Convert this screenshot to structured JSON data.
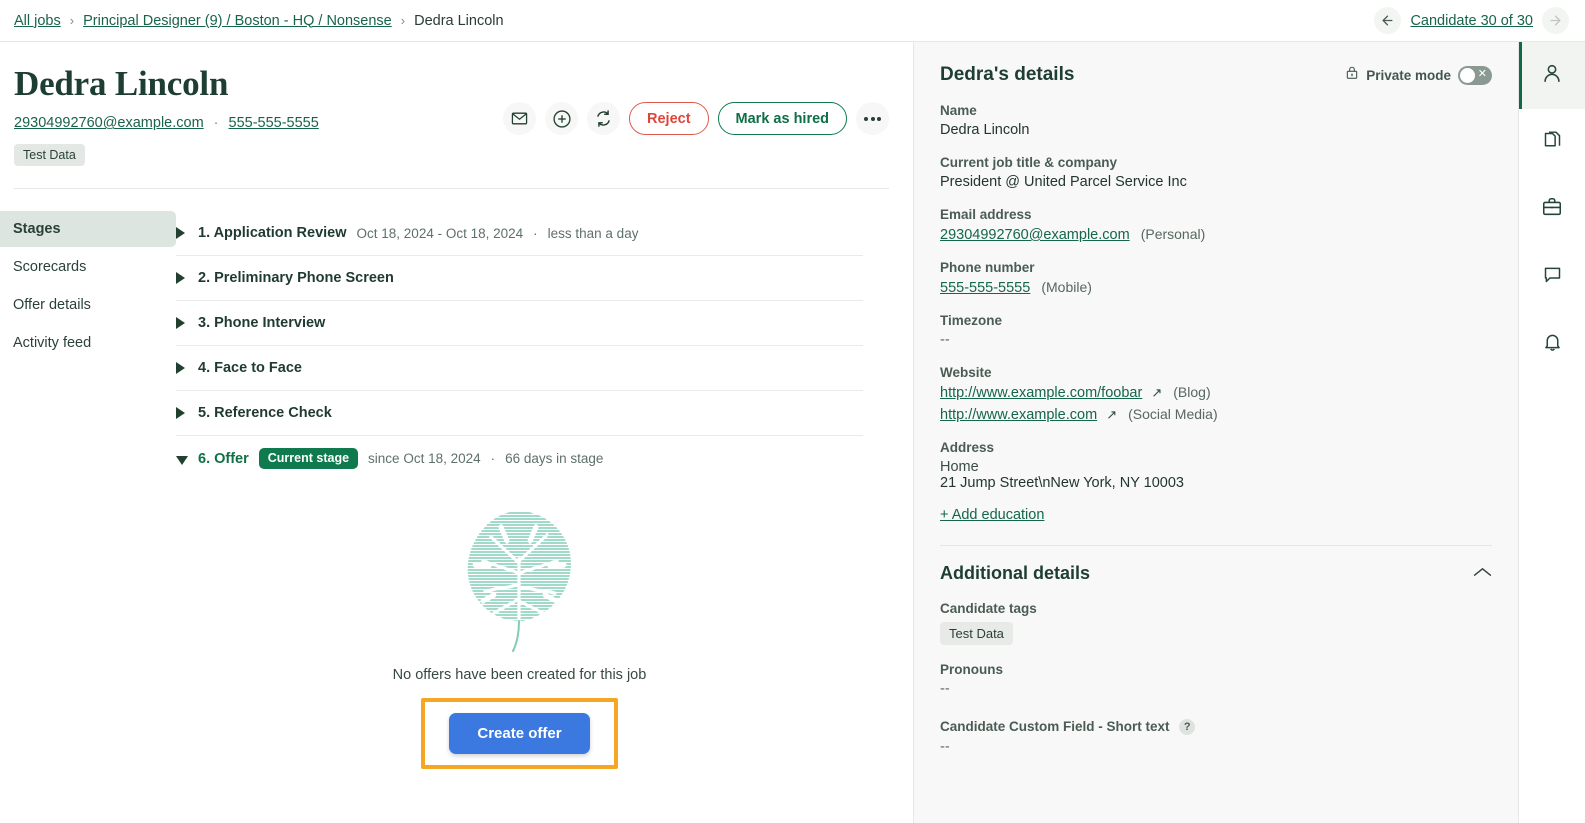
{
  "breadcrumb": {
    "all_jobs": "All jobs",
    "job": "Principal Designer (9) / Boston - HQ / Nonsense",
    "current": "Dedra Lincoln",
    "separator": "›"
  },
  "nav": {
    "back_icon": "arrow-left-icon",
    "forward_icon": "arrow-right-icon",
    "candidate_count": "Candidate 30 of 30"
  },
  "candidate": {
    "name": "Dedra Lincoln",
    "email": "29304992760@example.com",
    "phone": "555-555-5555",
    "separator": "·",
    "tag": "Test Data"
  },
  "actions": {
    "email_icon": "envelope-icon",
    "add_icon": "plus-circle-icon",
    "advance_icon": "refresh-icon",
    "reject_label": "Reject",
    "hire_label": "Mark as hired",
    "more_icon": "ellipsis-icon"
  },
  "side_nav": {
    "items": [
      {
        "label": "Stages",
        "active": true
      },
      {
        "label": "Scorecards",
        "active": false
      },
      {
        "label": "Offer details",
        "active": false
      },
      {
        "label": "Activity feed",
        "active": false
      }
    ]
  },
  "stages": [
    {
      "title": "1. Application Review",
      "meta_dates": "Oct 18, 2024 - Oct 18, 2024",
      "meta_duration": "less than a day",
      "expanded": false,
      "current": false
    },
    {
      "title": "2. Preliminary Phone Screen",
      "meta_dates": "",
      "meta_duration": "",
      "expanded": false,
      "current": false
    },
    {
      "title": "3. Phone Interview",
      "meta_dates": "",
      "meta_duration": "",
      "expanded": false,
      "current": false
    },
    {
      "title": "4. Face to Face",
      "meta_dates": "",
      "meta_duration": "",
      "expanded": false,
      "current": false
    },
    {
      "title": "5. Reference Check",
      "meta_dates": "",
      "meta_duration": "",
      "expanded": false,
      "current": false
    },
    {
      "title": "6. Offer",
      "badge": "Current stage",
      "meta_dates": "since Oct 18, 2024",
      "meta_duration": "66 days in stage",
      "expanded": true,
      "current": true
    }
  ],
  "offer_empty": {
    "illustration": "monstera-leaf-illustration",
    "message": "No offers have been created for this job",
    "create_button": "Create offer",
    "highlight_color": "#f5a623",
    "button_color": "#3b78e0"
  },
  "details": {
    "title": "Dedra's details",
    "private_mode": {
      "lock_icon": "lock-icon",
      "label": "Private mode",
      "state": "off",
      "off_mark": "✕"
    },
    "fields": [
      {
        "label": "Name",
        "value": "Dedra Lincoln"
      },
      {
        "label": "Current job title & company",
        "value": "President @ United Parcel Service Inc"
      },
      {
        "label": "Email address",
        "value": "29304992760@example.com",
        "qualifier": "(Personal)"
      },
      {
        "label": "Phone number",
        "value": "555-555-5555",
        "qualifier": "(Mobile)"
      },
      {
        "label": "Timezone",
        "value": "--"
      }
    ],
    "website": {
      "label": "Website",
      "links": [
        {
          "url": "http://www.example.com/foobar",
          "qualifier": "(Blog)"
        },
        {
          "url": "http://www.example.com",
          "qualifier": "(Social Media)"
        }
      ],
      "external_icon": "↗"
    },
    "address": {
      "label": "Address",
      "type": "Home",
      "value": "21 Jump Street\\nNew York, NY 10003"
    },
    "add_education": "+ Add education"
  },
  "additional": {
    "title": "Additional details",
    "collapse_icon": "chevron-up-icon",
    "candidate_tags_label": "Candidate tags",
    "candidate_tag": "Test Data",
    "pronouns_label": "Pronouns",
    "pronouns_value": "--",
    "custom_field_label": "Candidate Custom Field - Short text",
    "custom_field_help": "?",
    "custom_field_value": "--"
  },
  "rail": [
    {
      "icon": "person-icon",
      "active": true
    },
    {
      "icon": "documents-icon",
      "active": false
    },
    {
      "icon": "briefcase-icon",
      "active": false
    },
    {
      "icon": "comment-icon",
      "active": false
    },
    {
      "icon": "bell-icon",
      "active": false
    }
  ]
}
